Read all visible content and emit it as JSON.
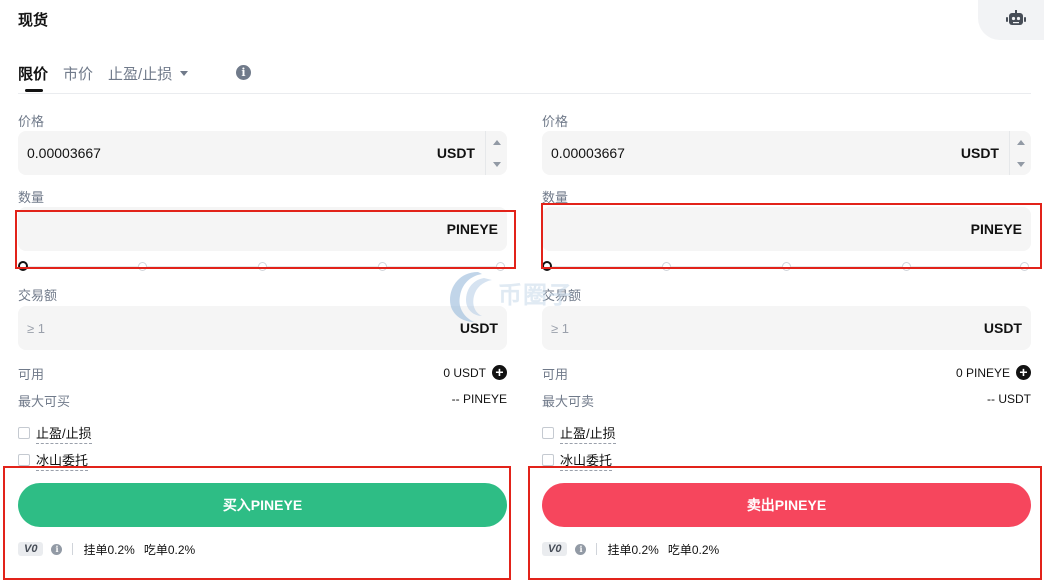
{
  "header": {
    "title": "现货",
    "bot_icon": "robot-icon"
  },
  "tabs": [
    {
      "label": "限价",
      "active": true
    },
    {
      "label": "市价",
      "active": false
    },
    {
      "label": "止盈/止损",
      "active": false,
      "dropdown": true
    }
  ],
  "buy": {
    "price_label": "价格",
    "price_value": "0.00003667",
    "price_unit": "USDT",
    "amount_label": "数量",
    "amount_value": "",
    "amount_unit": "PINEYE",
    "total_label": "交易额",
    "total_placeholder": "≥ 1",
    "total_unit": "USDT",
    "available_label": "可用",
    "available_value": "0 USDT",
    "max_label": "最大可买",
    "max_value": "-- PINEYE",
    "tpsl_label": "止盈/止损",
    "iceberg_label": "冰山委托",
    "button_label": "买入PINEYE",
    "vip_level": "V0",
    "maker_fee": "挂单0.2%",
    "taker_fee": "吃单0.2%"
  },
  "sell": {
    "price_label": "价格",
    "price_value": "0.00003667",
    "price_unit": "USDT",
    "amount_label": "数量",
    "amount_value": "",
    "amount_unit": "PINEYE",
    "total_label": "交易额",
    "total_placeholder": "≥ 1",
    "total_unit": "USDT",
    "available_label": "可用",
    "available_value": "0 PINEYE",
    "max_label": "最大可卖",
    "max_value": "-- USDT",
    "tpsl_label": "止盈/止损",
    "iceberg_label": "冰山委托",
    "button_label": "卖出PINEYE",
    "vip_level": "V0",
    "maker_fee": "挂单0.2%",
    "taker_fee": "吃单0.2%"
  },
  "watermark": "币圈子",
  "colors": {
    "buy": "#2ebd85",
    "sell": "#f6465d",
    "highlight": "#e2231a",
    "field_bg": "#f5f5f5",
    "muted_text": "#707a8a"
  }
}
